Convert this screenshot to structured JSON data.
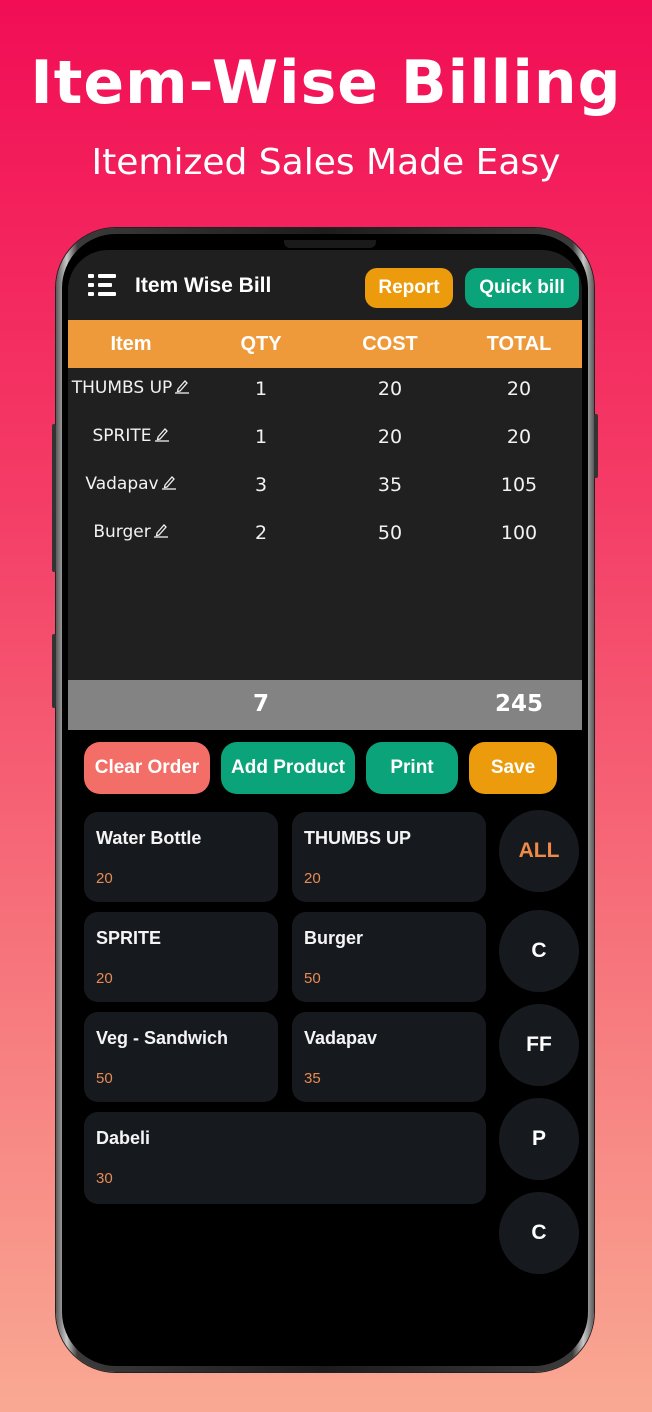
{
  "promo": {
    "title": "Item-Wise Billing",
    "subtitle": "Itemized Sales Made Easy"
  },
  "app_bar": {
    "menu_icon": "hamburger-list-icon",
    "title": "Item Wise Bill",
    "report_label": "Report",
    "quick_bill_label": "Quick bill"
  },
  "bill_table": {
    "headers": [
      "Item",
      "QTY",
      "COST",
      "TOTAL"
    ],
    "rows": [
      {
        "item": "THUMBS UP",
        "qty": "1",
        "cost": "20",
        "total": "20"
      },
      {
        "item": "SPRITE",
        "qty": "1",
        "cost": "20",
        "total": "20"
      },
      {
        "item": "Vadapav",
        "qty": "3",
        "cost": "35",
        "total": "105"
      },
      {
        "item": "Burger",
        "qty": "2",
        "cost": "50",
        "total": "100"
      }
    ],
    "edit_icon": "pencil-edit-icon",
    "totals": {
      "qty": "7",
      "total": "245"
    }
  },
  "actions": {
    "clear_order": "Clear Order",
    "add_product": "Add Product",
    "print": "Print",
    "save": "Save"
  },
  "products": [
    {
      "name": "Water Bottle",
      "price": "20"
    },
    {
      "name": "THUMBS UP",
      "price": "20"
    },
    {
      "name": "SPRITE",
      "price": "20"
    },
    {
      "name": "Burger",
      "price": "50"
    },
    {
      "name": "Veg - Sandwich",
      "price": "50"
    },
    {
      "name": "Vadapav",
      "price": "35"
    },
    {
      "name": "Dabeli",
      "price": "30"
    }
  ],
  "categories": [
    {
      "label": "ALL",
      "active": true
    },
    {
      "label": "C",
      "active": false
    },
    {
      "label": "FF",
      "active": false
    },
    {
      "label": "P",
      "active": false
    },
    {
      "label": "C",
      "active": false
    }
  ],
  "colors": {
    "background_top": "#f20d55",
    "background_bottom": "#f9a993",
    "header_orange": "#ef9a3a",
    "report_amber": "#eb9b0b",
    "green": "#0ba47a",
    "clear_red": "#f36e67",
    "price_orange": "#e78a54",
    "totals_gray": "#838383"
  }
}
